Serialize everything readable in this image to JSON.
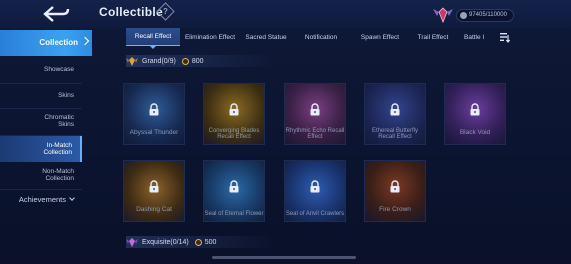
{
  "header": {
    "title": "Collectible",
    "info_icon": "diamond-question-icon",
    "info_glyph": "?",
    "currency": {
      "value": "97405",
      "max": "/110000",
      "icon": "winged-crest-icon"
    }
  },
  "sidebar": {
    "items": [
      {
        "label": "Collection",
        "icon": "chevron-right-icon"
      },
      {
        "label": "Showcase"
      },
      {
        "label": "Skins"
      },
      {
        "label": "Chromatic Skins"
      },
      {
        "label": "In-Match Collection"
      },
      {
        "label": "Non-Match Collection"
      },
      {
        "label": "Achievements",
        "icon": "chevron-down-icon"
      }
    ]
  },
  "tabs": [
    {
      "label": "Recall Effect"
    },
    {
      "label": "Elimination Effect"
    },
    {
      "label": "Sacred Statue"
    },
    {
      "label": "Notification"
    },
    {
      "label": "Spawn Effect"
    },
    {
      "label": "Trail Effect"
    },
    {
      "label": "Battle I"
    }
  ],
  "sections": [
    {
      "title": "Grand(0/9)",
      "points": "800",
      "rank_color": "#d9a441"
    },
    {
      "title": "Exquisite(0/14)",
      "points": "500",
      "rank_color": "#c46be0"
    }
  ],
  "cards": [
    {
      "name": "Abyssal Thunder",
      "art_color": "#1d3a6b"
    },
    {
      "name": "Converging Blades Recall Effect",
      "art_color": "#6b5418"
    },
    {
      "name": "Rhythmic Echo Recall Effect",
      "art_color": "#5a2b5c"
    },
    {
      "name": "Ethereal Butterfly Recall Effect",
      "art_color": "#1f2f6e"
    },
    {
      "name": "Black Void",
      "art_color": "#4a2a72"
    },
    {
      "name": "Dashing Cat",
      "art_color": "#6b4a1c"
    },
    {
      "name": "Seal of Eternal Flower",
      "art_color": "#1b4a7a"
    },
    {
      "name": "Seal of Anvil Crawlers",
      "art_color": "#1f3f80"
    },
    {
      "name": "Fire Crown",
      "art_color": "#5a2c1a"
    }
  ],
  "colors": {
    "accent": "#3aa2f2",
    "gold": "#d9b45a",
    "background": "#0b1430"
  }
}
